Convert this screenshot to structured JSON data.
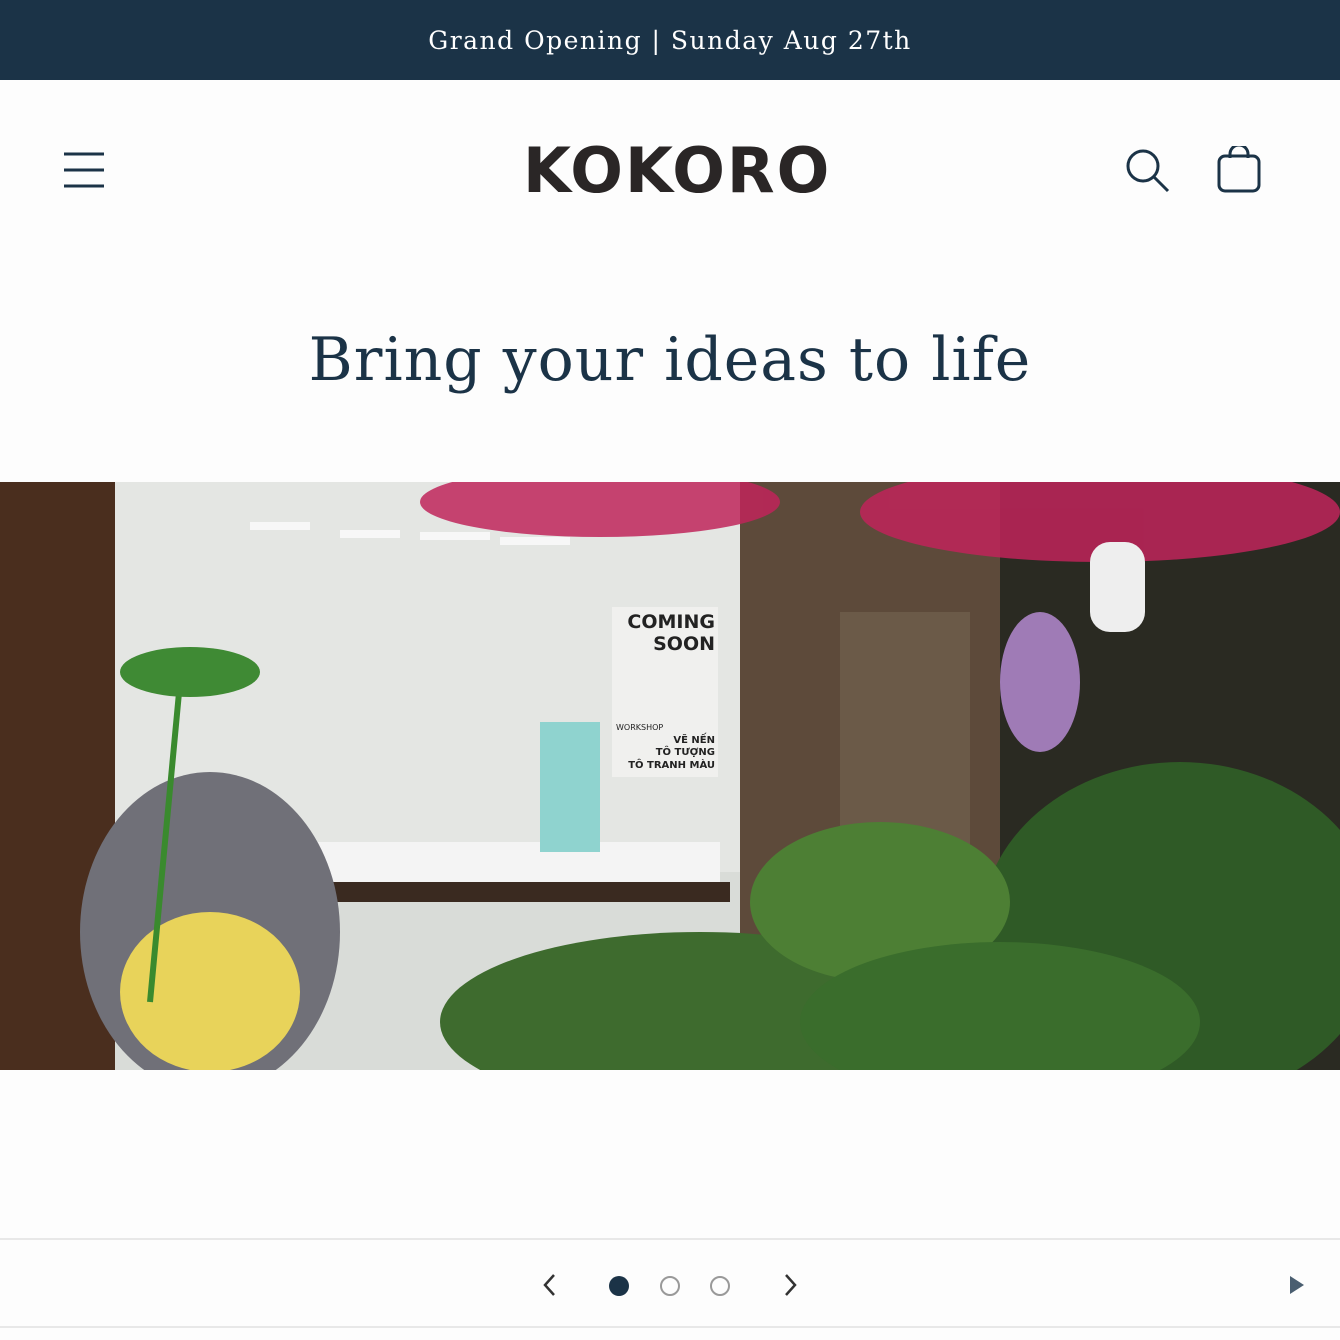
{
  "announcement": "Grand Opening | Sunday Aug 27th",
  "logo": "KOKORO",
  "hero": {
    "title": "Bring your ideas to life",
    "image_alt": "Kokoro store front with Totoro statue and plants",
    "sign_text": [
      "COMING SOON",
      "WORKSHOP",
      "VẼ NẾN",
      "TÔ TƯỢNG",
      "TÔ TRANH MÀU"
    ]
  },
  "slideshow": {
    "current_slide": 1,
    "total_slides": 3
  },
  "colors": {
    "primary": "#1b3347"
  }
}
